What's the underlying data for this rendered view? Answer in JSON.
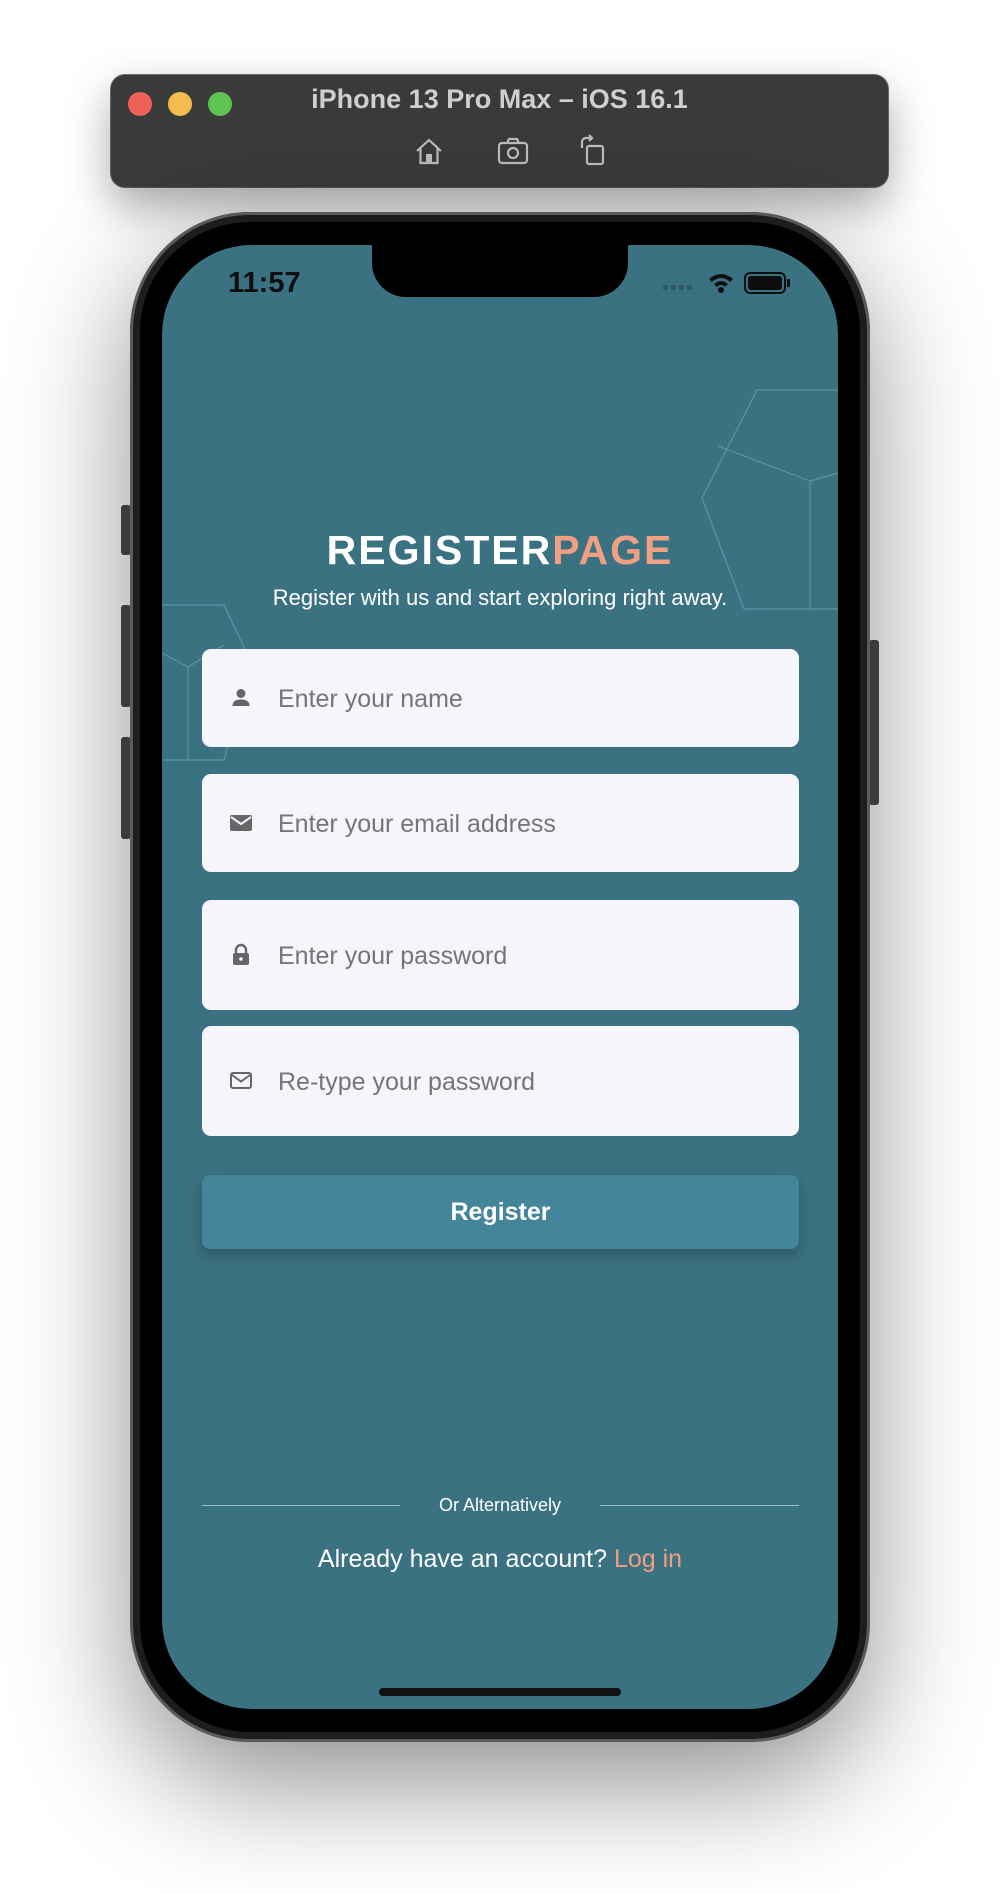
{
  "window": {
    "title": "iPhone 13 Pro Max – iOS 16.1",
    "toolbar": [
      {
        "icon": "home-icon"
      },
      {
        "icon": "screenshot-icon"
      },
      {
        "icon": "rotate-icon"
      }
    ]
  },
  "status_bar": {
    "time": "11:57",
    "icons": [
      "signal-icon",
      "wifi-icon",
      "battery-icon"
    ]
  },
  "header": {
    "title_part1": "REGISTER",
    "title_part2": "PAGE",
    "subtitle": "Register with us and start exploring right away."
  },
  "form": {
    "fields": [
      {
        "icon": "person-icon",
        "placeholder": "Enter your name",
        "value": ""
      },
      {
        "icon": "mail-icon",
        "placeholder": "Enter your email address",
        "value": ""
      },
      {
        "icon": "lock-icon",
        "placeholder": "Enter your password",
        "value": ""
      },
      {
        "icon": "mail-outline-icon",
        "placeholder": "Re-type your password",
        "value": ""
      }
    ],
    "submit_label": "Register"
  },
  "footer": {
    "divider_text": "Or Alternatively",
    "question": "Already have an account?",
    "login_link": "Log in"
  },
  "colors": {
    "screen_bg": "#3b7282",
    "accent": "#f09f82",
    "button_bg": "#448599",
    "field_bg": "#f6f5fb"
  }
}
